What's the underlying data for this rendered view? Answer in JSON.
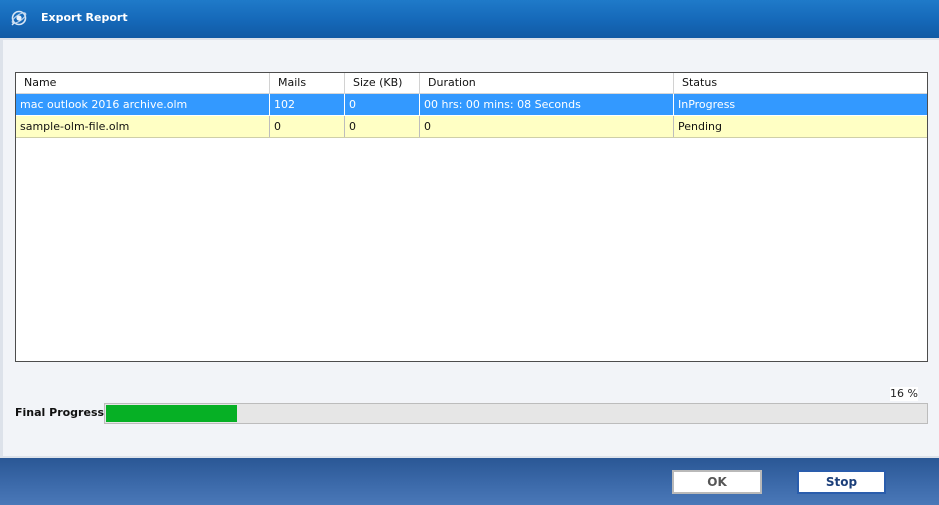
{
  "window": {
    "title": "Export Report"
  },
  "table": {
    "columns": [
      "Name",
      "Mails",
      "Size (KB)",
      "Duration",
      "Status"
    ],
    "rows": [
      [
        "mac outlook 2016 archive.olm",
        "102",
        "0",
        "00 hrs: 00 mins: 08 Seconds",
        "InProgress"
      ],
      [
        "sample-olm-file.olm",
        "0",
        "0",
        "0",
        "Pending"
      ]
    ]
  },
  "progress": {
    "label": "Final Progress :",
    "percent_text": "16 %",
    "value": 0.16
  },
  "buttons": {
    "ok": "OK",
    "stop": "Stop"
  },
  "colors": {
    "titlebar": "#1568b8",
    "selected_row": "#3399ff",
    "pending_row": "#ffffc4",
    "progress_fill": "#06b025",
    "footer": "#3a68a8"
  },
  "icons": {
    "app": "app-logo-icon"
  }
}
